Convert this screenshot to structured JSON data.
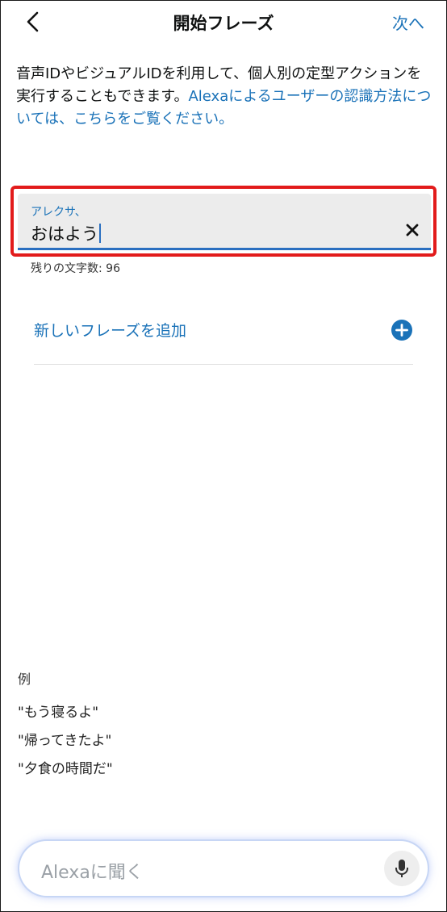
{
  "header": {
    "title": "開始フレーズ",
    "next_label": "次へ"
  },
  "description": {
    "text": "音声IDやビジュアルIDを利用して、個人別の定型アクションを実行することもできます。",
    "link": "Alexaによるユーザーの認識方法については、こちらをご覧ください。"
  },
  "phrase_input": {
    "label": "アレクサ、",
    "value": "おはよう",
    "counter": "残りの文字数: 96"
  },
  "add_phrase": {
    "label": "新しいフレーズを追加"
  },
  "examples": {
    "title": "例",
    "items": [
      "\"もう寝るよ\"",
      "\"帰ってきたよ\"",
      "\"夕食の時間だ\""
    ]
  },
  "alexa_bar": {
    "placeholder": "Alexaに聞く"
  },
  "colors": {
    "accent": "#1a72b8",
    "highlight_border": "#e21b1b",
    "input_underline": "#2a6fc0"
  },
  "icons": [
    "chevron-left-icon",
    "clear-x-icon",
    "plus-circle-icon",
    "microphone-icon"
  ]
}
